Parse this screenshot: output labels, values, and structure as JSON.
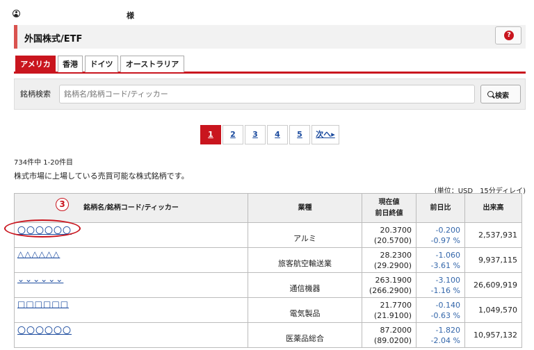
{
  "user": {
    "suffix": "様"
  },
  "header": {
    "title": "外国株式/ETF",
    "help_label": "?"
  },
  "tabs": [
    {
      "label": "アメリカ",
      "active": true
    },
    {
      "label": "香港",
      "active": false
    },
    {
      "label": "ドイツ",
      "active": false
    },
    {
      "label": "オーストラリア",
      "active": false
    }
  ],
  "search": {
    "label": "銘柄検索",
    "placeholder": "銘柄名/銘柄コード/ティッカー",
    "button_label": "検索"
  },
  "pagination": {
    "pages": [
      "1",
      "2",
      "3",
      "4",
      "5"
    ],
    "current": "1",
    "next_label": "次へ▸"
  },
  "results": {
    "count_text": "734件中 1-20件目",
    "description": "株式市場に上場している売買可能な株式銘柄です。",
    "unit_text": "(単位：USD　15分ディレイ)"
  },
  "table": {
    "headers": {
      "name": "銘柄名/銘柄コード/ティッカー",
      "industry": "業種",
      "price_current": "現在値",
      "price_prev": "前日終値",
      "change": "前日比",
      "volume": "出来高"
    },
    "rows": [
      {
        "name": "〇〇〇〇〇〇",
        "industry": "アルミ",
        "price": "20.3700",
        "prev": "(20.5700)",
        "chg": "-0.200",
        "chg_pct": "-0.97 %",
        "volume": "2,537,931"
      },
      {
        "name": "△△△△△△",
        "industry": "旅客航空輸送業",
        "price": "28.2300",
        "prev": "(29.2900)",
        "chg": "-1.060",
        "chg_pct": "-3.61 %",
        "volume": "9,937,115"
      },
      {
        "name": "⌄⌄⌄⌄⌄⌄",
        "industry": "通信機器",
        "price": "263.1900",
        "prev": "(266.2900)",
        "chg": "-3.100",
        "chg_pct": "-1.16 %",
        "volume": "26,609,919"
      },
      {
        "name": "□□□□□□",
        "industry": "電気製品",
        "price": "21.7700",
        "prev": "(21.9100)",
        "chg": "-0.140",
        "chg_pct": "-0.63 %",
        "volume": "1,049,570"
      },
      {
        "name": "〇〇〇〇〇〇",
        "industry": "医薬品総合",
        "price": "87.2000",
        "prev": "(89.0200)",
        "chg": "-1.820",
        "chg_pct": "-2.04 %",
        "volume": "10,957,132"
      }
    ]
  },
  "annotation": {
    "marker": "3"
  },
  "colors": {
    "accent": "#c9151e",
    "link": "#1a4a9e",
    "change": "#3366aa"
  }
}
